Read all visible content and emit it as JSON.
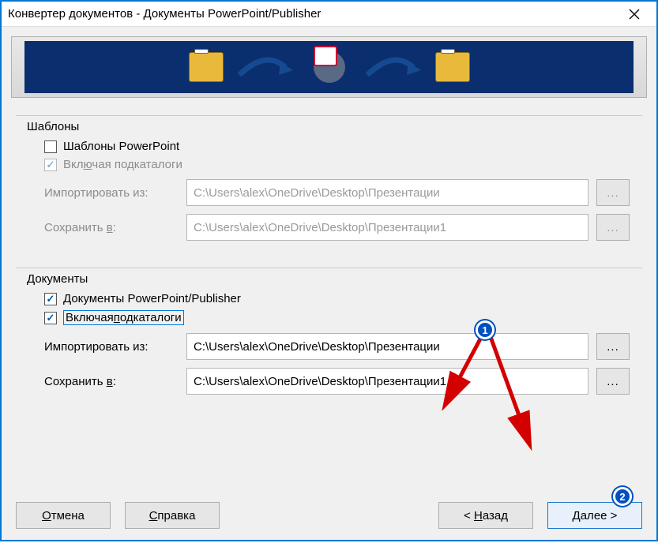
{
  "title": "Конвертер документов - Документы PowerPoint/Publisher",
  "templates": {
    "legend": "Шаблоны",
    "cb_powerpoint": "Шаблоны PowerPoint",
    "cb_subdirs_pre": "Вкл",
    "cb_subdirs_u": "ю",
    "cb_subdirs_post": "чая подкаталоги",
    "import_label": "Импортировать из:",
    "import_value": "C:\\Users\\alex\\OneDrive\\Desktop\\Презентации",
    "save_pre": "Сохранить ",
    "save_u": "в",
    "save_post": ":",
    "save_value": "C:\\Users\\alex\\OneDrive\\Desktop\\Презентации1",
    "browse": "..."
  },
  "documents": {
    "legend": "Документы",
    "cb_docs": "Документы PowerPoint/Publisher",
    "cb_subdirs_pre": "Включая ",
    "cb_subdirs_u": "п",
    "cb_subdirs_post": "одкаталоги",
    "import_label": "Импортировать из:",
    "import_value": "C:\\Users\\alex\\OneDrive\\Desktop\\Презентации",
    "save_pre": "Сохранить ",
    "save_u": "в",
    "save_post": ":",
    "save_value": "C:\\Users\\alex\\OneDrive\\Desktop\\Презентации1",
    "browse": "..."
  },
  "buttons": {
    "cancel_u": "О",
    "cancel_post": "тмена",
    "help_u": "С",
    "help_post": "правка",
    "back_pre": "< ",
    "back_u": "Н",
    "back_post": "азад",
    "next_u": "Д",
    "next_post": "алее >"
  },
  "annotations": {
    "1": "1",
    "2": "2"
  }
}
